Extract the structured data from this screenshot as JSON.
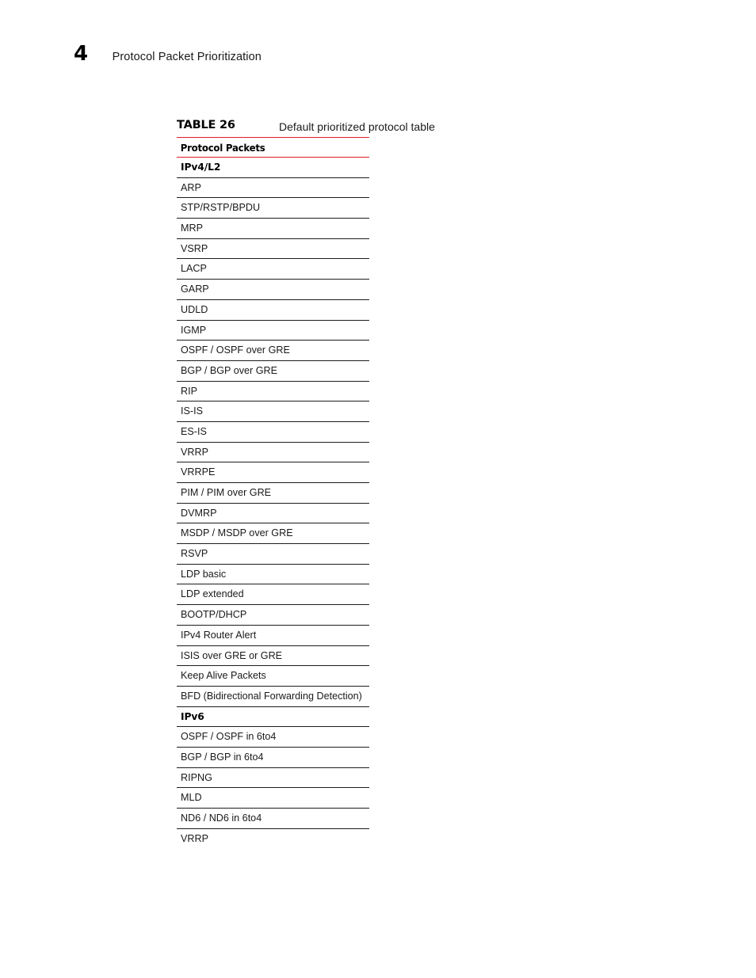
{
  "page": {
    "chapter_number": "4",
    "chapter_title": "Protocol Packet Prioritization"
  },
  "table": {
    "label": "TABLE 26",
    "caption": "Default prioritized protocol table",
    "column_header": "Protocol Packets",
    "accent_color": "#e01b26",
    "rule_color": "#1c1c1c",
    "rows": [
      {
        "label": "IPv4/L2",
        "group": true
      },
      {
        "label": "ARP",
        "group": false
      },
      {
        "label": "STP/RSTP/BPDU",
        "group": false
      },
      {
        "label": "MRP",
        "group": false
      },
      {
        "label": "VSRP",
        "group": false
      },
      {
        "label": "LACP",
        "group": false
      },
      {
        "label": "GARP",
        "group": false
      },
      {
        "label": "UDLD",
        "group": false
      },
      {
        "label": "IGMP",
        "group": false
      },
      {
        "label": "OSPF / OSPF over GRE",
        "group": false
      },
      {
        "label": "BGP / BGP over GRE",
        "group": false
      },
      {
        "label": "RIP",
        "group": false
      },
      {
        "label": "IS-IS",
        "group": false
      },
      {
        "label": "ES-IS",
        "group": false
      },
      {
        "label": "VRRP",
        "group": false
      },
      {
        "label": "VRRPE",
        "group": false
      },
      {
        "label": "PIM / PIM over GRE",
        "group": false
      },
      {
        "label": "DVMRP",
        "group": false
      },
      {
        "label": "MSDP / MSDP over GRE",
        "group": false
      },
      {
        "label": "RSVP",
        "group": false
      },
      {
        "label": "LDP basic",
        "group": false
      },
      {
        "label": "LDP extended",
        "group": false
      },
      {
        "label": "BOOTP/DHCP",
        "group": false
      },
      {
        "label": "IPv4 Router Alert",
        "group": false
      },
      {
        "label": "ISIS over GRE or GRE",
        "group": false
      },
      {
        "label": "Keep Alive Packets",
        "group": false
      },
      {
        "label": "BFD (Bidirectional Forwarding Detection)",
        "group": false
      },
      {
        "label": "IPv6",
        "group": true
      },
      {
        "label": "OSPF / OSPF in 6to4",
        "group": false
      },
      {
        "label": "BGP / BGP in 6to4",
        "group": false
      },
      {
        "label": "RIPNG",
        "group": false
      },
      {
        "label": "MLD",
        "group": false
      },
      {
        "label": "ND6 / ND6 in 6to4",
        "group": false
      },
      {
        "label": "VRRP",
        "group": false
      }
    ]
  }
}
